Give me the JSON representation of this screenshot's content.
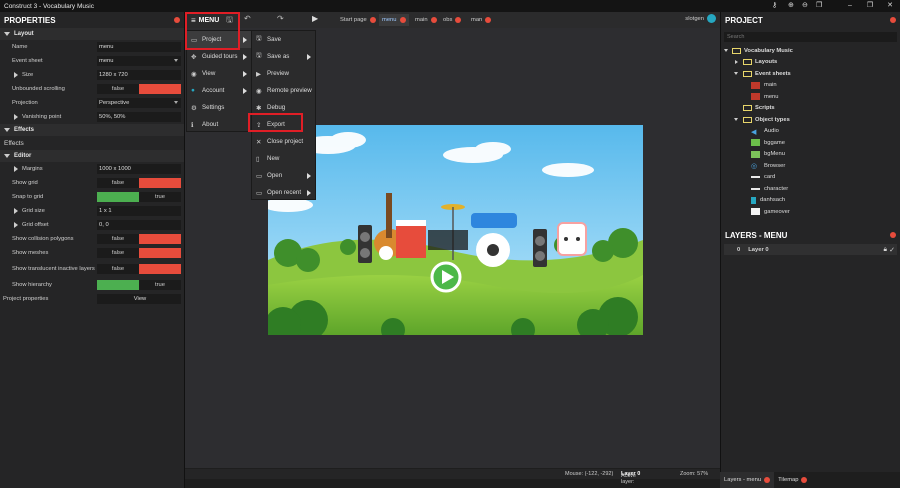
{
  "window": {
    "title": "Construct 3 - Vocabulary Music"
  },
  "properties": {
    "title": "PROPERTIES",
    "layout_header": "Layout",
    "name_label": "Name",
    "name_value": "menu",
    "event_sheet_label": "Event sheet",
    "event_sheet_value": "menu",
    "size_label": "Size",
    "size_value": "1280 x 720",
    "unbounded_label": "Unbounded scrolling",
    "unbounded_value": "false",
    "projection_label": "Projection",
    "projection_value": "Perspective",
    "vanishing_label": "Vanishing point",
    "vanishing_value": "50%, 50%",
    "effects_header": "Effects",
    "effects_button": "Effects",
    "editor_header": "Editor",
    "margins_label": "Margins",
    "margins_value": "1000 x 1000",
    "show_grid_label": "Show grid",
    "show_grid_value": "false",
    "snap_label": "Snap to grid",
    "snap_value": "true",
    "grid_size_label": "Grid size",
    "grid_size_value": "1 x 1",
    "grid_offset_label": "Grid offset",
    "grid_offset_value": "0, 0",
    "collision_label": "Show collision polygons",
    "collision_value": "false",
    "meshes_label": "Show meshes",
    "meshes_value": "false",
    "translucent_label": "Show translucent inactive layers",
    "translucent_value": "false",
    "hierarchy_label": "Show hierarchy",
    "hierarchy_value": "true",
    "project_props_label": "Project properties",
    "project_props_button": "View"
  },
  "toolbar": {
    "menu_label": "MENU",
    "tabs": [
      "Start page",
      "menu",
      "main",
      "obs",
      "man"
    ],
    "user": "slotgen"
  },
  "main_menu": {
    "items": [
      "Project",
      "Guided tours",
      "View",
      "Account",
      "Settings",
      "About"
    ]
  },
  "project_menu": {
    "items": [
      "Save",
      "Save as",
      "Preview",
      "Remote preview",
      "Debug",
      "Export",
      "Close project",
      "New",
      "Open",
      "Open recent"
    ]
  },
  "project_panel": {
    "title": "PROJECT",
    "search_placeholder": "Search",
    "root": "Vocabulary Music",
    "layouts": "Layouts",
    "event_sheets": "Event sheets",
    "sheets": [
      "main",
      "menu"
    ],
    "scripts": "Scripts",
    "object_types": "Object types",
    "objects": [
      "Audio",
      "bggame",
      "bgMenu",
      "Browser",
      "card",
      "character",
      "danhsach",
      "gameover"
    ]
  },
  "layers_panel": {
    "title": "LAYERS - MENU",
    "layer_index": "0",
    "layer_name": "Layer 0"
  },
  "status": {
    "mouse": "Mouse: (-122, -292)",
    "active_layer_label": "Active layer: ",
    "active_layer": "Layer 0",
    "zoom": "Zoom: 57%"
  },
  "bottom_tabs": [
    "Layers - menu",
    "Tilemap"
  ]
}
